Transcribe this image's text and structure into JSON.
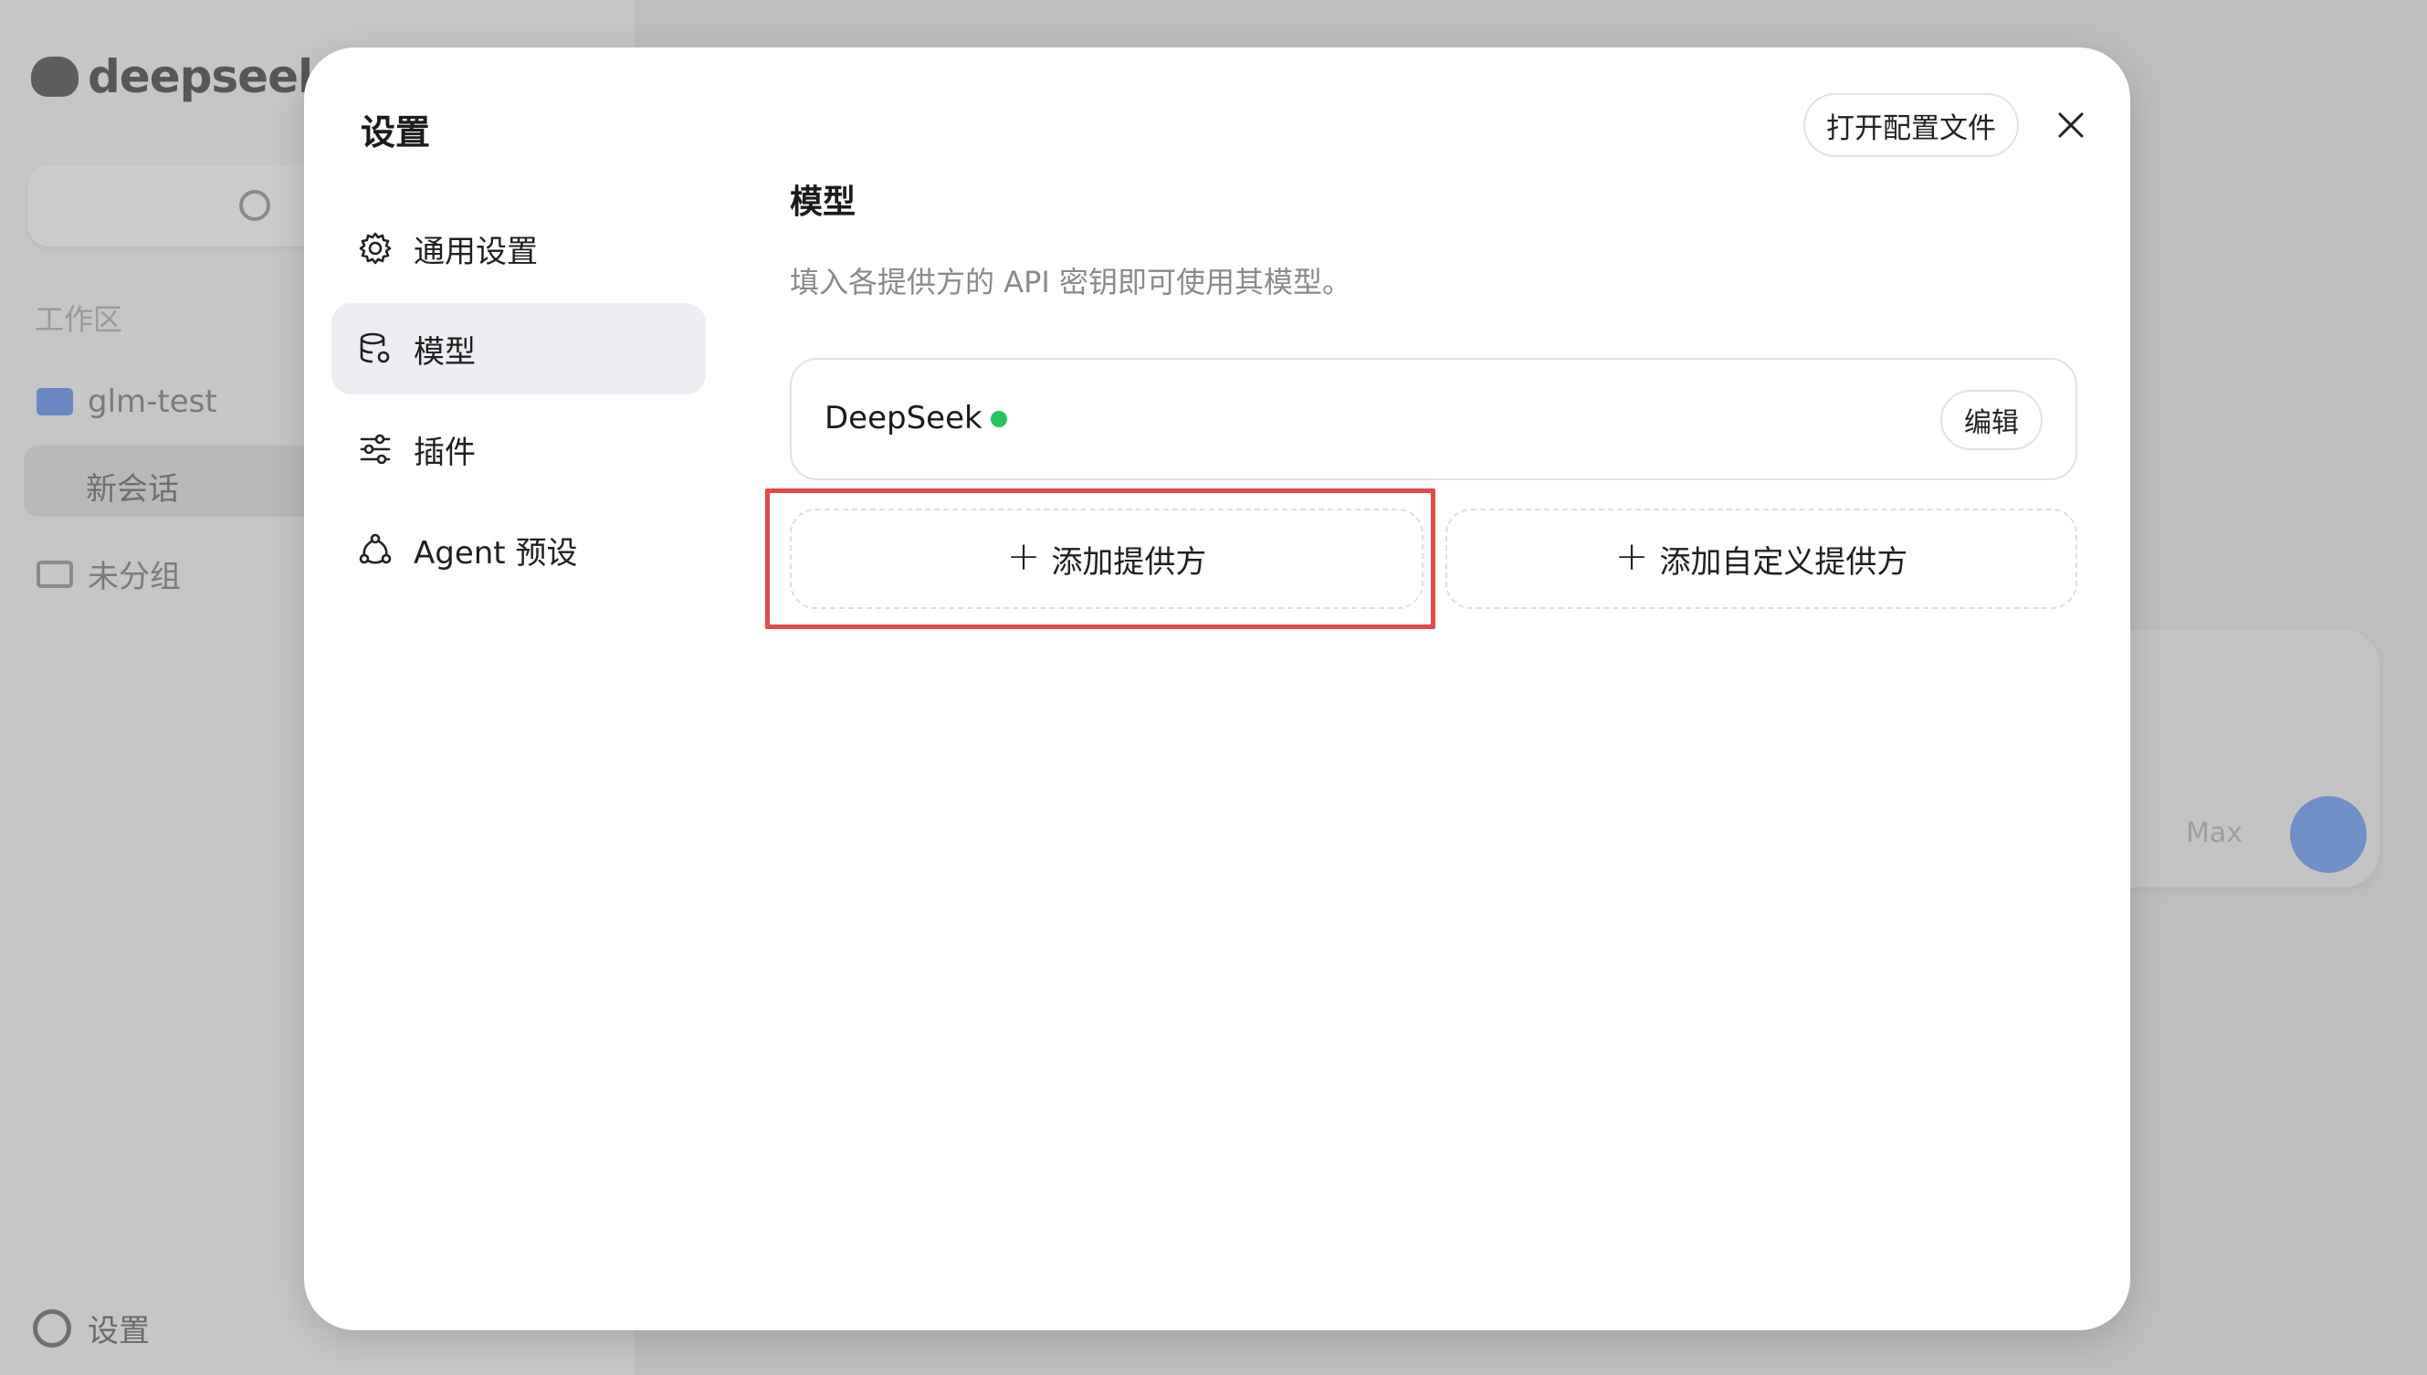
{
  "background": {
    "logo_text": "deepseek",
    "workspace_title": "工作区",
    "project_name": "glm-test",
    "chat_name": "新会话",
    "ungrouped": "未分组",
    "settings_label": "设置",
    "model_selector": "Max"
  },
  "modal": {
    "title": "设置",
    "open_config_label": "打开配置文件",
    "nav": [
      {
        "label": "通用设置",
        "icon": "gear-icon"
      },
      {
        "label": "模型",
        "icon": "database-icon",
        "active": true
      },
      {
        "label": "插件",
        "icon": "sliders-icon"
      },
      {
        "label": "Agent 预设",
        "icon": "agent-icon"
      }
    ],
    "section": {
      "title": "模型",
      "description": "填入各提供方的 API 密钥即可使用其模型。"
    },
    "providers": [
      {
        "name": "DeepSeek",
        "status": "active",
        "status_color": "#22c55e",
        "edit_label": "编辑"
      }
    ],
    "add_provider_label": "添加提供方",
    "add_custom_provider_label": "添加自定义提供方"
  },
  "colors": {
    "highlight": "#e5484d",
    "active_nav_bg": "#eceef2"
  }
}
